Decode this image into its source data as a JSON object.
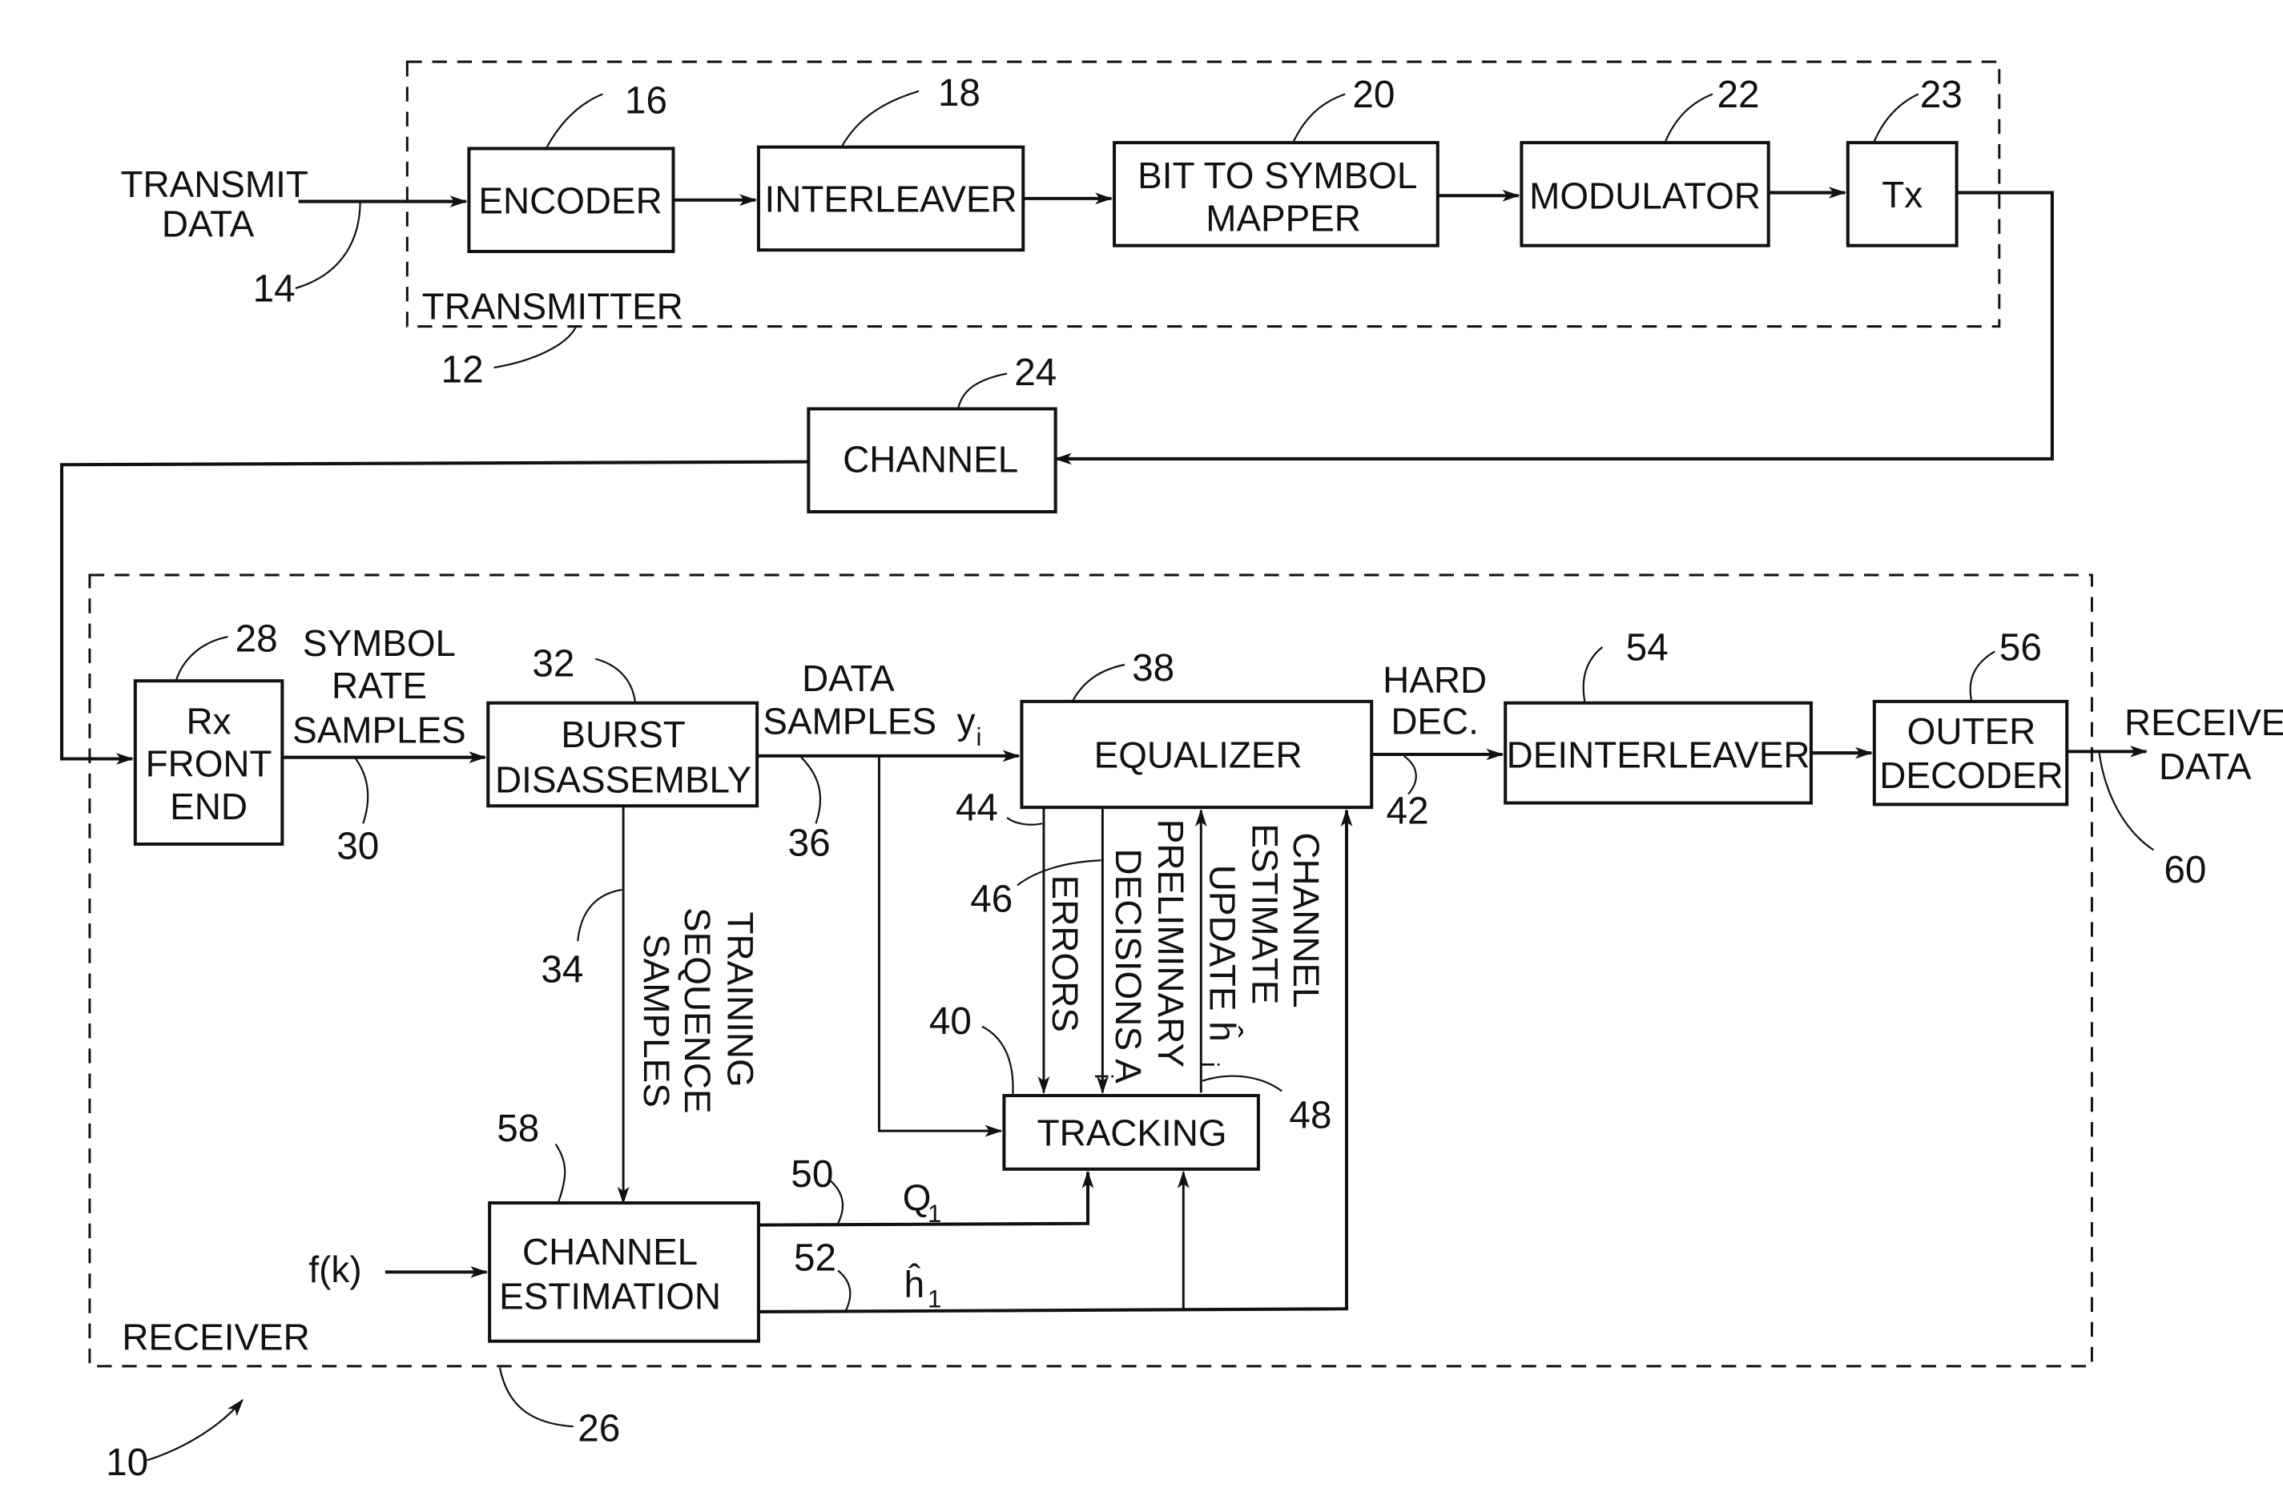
{
  "figure": {
    "reference": "10",
    "transmitter": {
      "label": "TRANSMITTER",
      "ref": "12",
      "input_label_line1": "TRANSMIT",
      "input_label_line2": "DATA",
      "input_ref": "14",
      "blocks": [
        {
          "id": "encoder",
          "lines": [
            "ENCODER"
          ],
          "ref": "16"
        },
        {
          "id": "interleaver",
          "lines": [
            "INTERLEAVER"
          ],
          "ref": "18"
        },
        {
          "id": "mapper",
          "lines": [
            "BIT TO SYMBOL",
            "MAPPER"
          ],
          "ref": "20"
        },
        {
          "id": "modulator",
          "lines": [
            "MODULATOR"
          ],
          "ref": "22"
        },
        {
          "id": "tx",
          "lines": [
            "Tx"
          ],
          "ref": "23"
        }
      ]
    },
    "channel": {
      "label": "CHANNEL",
      "ref": "24"
    },
    "receiver": {
      "label": "RECEIVER",
      "ref": "26",
      "blocks": {
        "rx_front_end": {
          "lines": [
            "Rx",
            "FRONT",
            "END"
          ],
          "ref": "28"
        },
        "burst_disassembly": {
          "lines": [
            "BURST",
            "DISASSEMBLY"
          ],
          "ref": "32"
        },
        "equalizer": {
          "lines": [
            "EQUALIZER"
          ],
          "ref": "38"
        },
        "tracking": {
          "lines": [
            "TRACKING"
          ],
          "ref": "40"
        },
        "channel_estimation": {
          "lines": [
            "CHANNEL",
            "ESTIMATION"
          ],
          "ref": "58"
        },
        "deinterleaver": {
          "lines": [
            "DEINTERLEAVER"
          ],
          "ref": "54"
        },
        "outer_decoder": {
          "lines": [
            "OUTER",
            "DECODER"
          ],
          "ref": "56"
        }
      },
      "signals": {
        "symbol_rate_samples": {
          "lines": [
            "SYMBOL",
            "RATE",
            "SAMPLES"
          ],
          "ref": "30"
        },
        "data_samples": {
          "lines": [
            "DATA",
            "SAMPLES"
          ],
          "symbol": "y",
          "subscript": "i",
          "ref": "36"
        },
        "training_sequence_samples": {
          "lines": [
            "TRAINING",
            "SEQUENCE",
            "SAMPLES"
          ],
          "ref": "34"
        },
        "hard_dec": {
          "lines": [
            "HARD",
            "DEC."
          ],
          "ref": "42"
        },
        "errors": {
          "label": "ERRORS",
          "ref": "44"
        },
        "preliminary_decisions": {
          "lines": [
            "PRELIMINARY",
            "DECISIONS A"
          ],
          "subscript": "i",
          "ref": "46"
        },
        "update": {
          "label": "UPDATE ĥ",
          "subscript": "i",
          "ref": "48"
        },
        "channel_estimate": {
          "lines": [
            "CHANNEL",
            "ESTIMATE"
          ]
        },
        "q1": {
          "symbol": "Q",
          "subscript": "1",
          "ref": "50"
        },
        "h1": {
          "symbol": "ĥ",
          "subscript": "1",
          "ref": "52"
        },
        "fk": {
          "label": "f(k)"
        },
        "receive_data": {
          "lines": [
            "RECEIVE",
            "DATA"
          ],
          "ref": "60"
        }
      }
    }
  }
}
